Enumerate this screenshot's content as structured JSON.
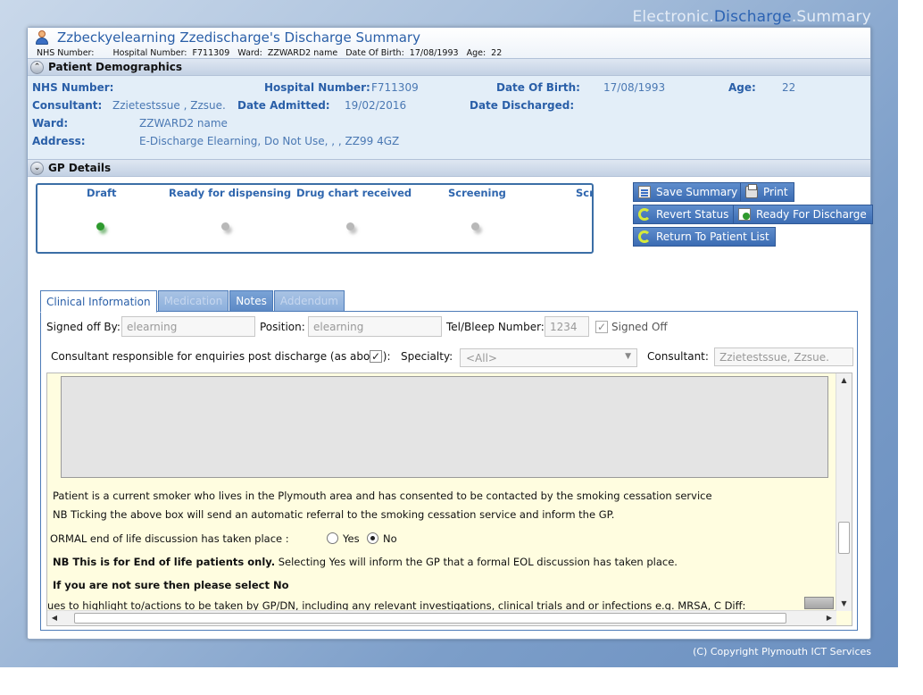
{
  "brand": {
    "part1": "Electronic.",
    "part2": "Discharge",
    "part3": ".Summary"
  },
  "header": {
    "title": "Zzbeckyelearning Zzedischarge's Discharge Summary",
    "nhs_label": "NHS Number:",
    "nhs_value": "",
    "hosp_label": "Hospital Number:",
    "hosp_value": "F711309",
    "ward_label": "Ward:",
    "ward_value": "ZZWARD2 name",
    "dob_label": "Date Of Birth:",
    "dob_value": "17/08/1993",
    "age_label": "Age:",
    "age_value": "22"
  },
  "demographics": {
    "heading": "Patient Demographics",
    "nhs_label": "NHS Number:",
    "hosp_label": "Hospital Number:",
    "hosp_value": "F711309",
    "dob_label": "Date Of Birth:",
    "dob_value": "17/08/1993",
    "age_label": "Age:",
    "age_value": "22",
    "consultant_label": "Consultant:",
    "consultant_value": "Zzietestssue , Zzsue.",
    "admitted_label": "Date Admitted:",
    "admitted_value": "19/02/2016",
    "discharged_label": "Date Discharged:",
    "ward_label": "Ward:",
    "ward_value": "ZZWARD2 name",
    "address_label": "Address:",
    "address_value": "E-Discharge Elearning, Do Not Use, , , ZZ99 4GZ"
  },
  "gp": {
    "heading": "GP Details"
  },
  "status_steps": [
    {
      "label": "Draft",
      "state": "complete"
    },
    {
      "label": "Ready for dispensing",
      "state": "pending"
    },
    {
      "label": "Drug chart received",
      "state": "pending"
    },
    {
      "label": "Screening",
      "state": "pending"
    },
    {
      "label": "Scr",
      "state": "pending"
    }
  ],
  "buttons": {
    "save": "Save Summary",
    "print": "Print",
    "revert": "Revert Status",
    "ready": "Ready For Discharge",
    "return": "Return To Patient List"
  },
  "tabs": [
    {
      "label": "Clinical Information",
      "active": true
    },
    {
      "label": "Medication",
      "active": false
    },
    {
      "label": "Notes",
      "active": false
    },
    {
      "label": "Addendum",
      "active": false
    }
  ],
  "form": {
    "signed_off_by_label": "Signed off By:",
    "signed_off_by_value": "elearning",
    "position_label": "Position:",
    "position_value": "elearning",
    "tel_label": "Tel/Bleep Number:",
    "tel_value": "1234",
    "signed_off_label": "Signed Off",
    "signed_off_checked": true,
    "consultant_resp_label": "Consultant responsible for enquiries post discharge (as above):",
    "consultant_resp_checked": true,
    "specialty_label": "Specialty:",
    "specialty_value": "<All>",
    "consultant_label": "Consultant:",
    "consultant_value": "Zzietestssue, Zzsue."
  },
  "content": {
    "smoker_line": "Patient is a current smoker who lives in the Plymouth area and has consented to be contacted by the smoking cessation service",
    "nb_referral": "NB Ticking the above box will send an automatic referral to the smoking cessation service and inform the GP.",
    "eol_question": "ORMAL end of life discussion has taken place :",
    "yes_label": "Yes",
    "no_label": "No",
    "eol_selected": "No",
    "nb_bold": "NB This is for End of life patients only.",
    "nb_rest": " Selecting Yes will inform the GP that a formal EOL discussion has taken place.",
    "unsure": "If you are not sure then please select No",
    "cutoff": "ues to highlight to/actions to be taken by GP/DN, including any relevant investigations, clinical trials and or infections e.g. MRSA, C Diff:"
  },
  "footer": {
    "copyright": "(C) Copyright Plymouth ICT Services"
  },
  "colors": {
    "accent": "#2a5fa8",
    "brand_highlight": "#2c63b3",
    "status_complete": "#2e9a2e",
    "status_pending": "#b8b8b8"
  }
}
